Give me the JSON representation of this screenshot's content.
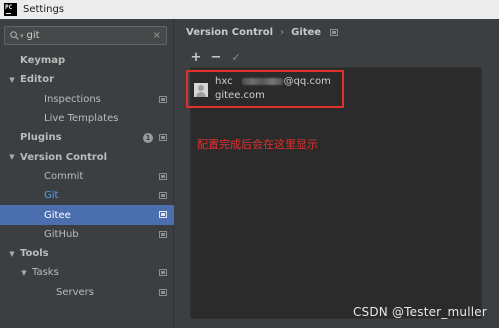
{
  "window": {
    "title": "Settings",
    "app_icon_text": "PC"
  },
  "search": {
    "value": "git",
    "caret": "▾",
    "clear": "×"
  },
  "tree": [
    {
      "label": "Keymap",
      "bold": true,
      "indent": 0
    },
    {
      "label": "Editor",
      "bold": true,
      "indent": 0,
      "arrow": "▼"
    },
    {
      "label": "Inspections",
      "indent": 2,
      "proj": true
    },
    {
      "label": "Live Templates",
      "indent": 2
    },
    {
      "label": "Plugins",
      "bold": true,
      "indent": 0,
      "badge": "1",
      "proj": true
    },
    {
      "label": "Version Control",
      "bold": true,
      "indent": 0,
      "arrow": "▼"
    },
    {
      "label": "Commit",
      "indent": 2,
      "proj": true
    },
    {
      "label": "Git",
      "indent": 2,
      "proj": true,
      "link": true
    },
    {
      "label": "Gitee",
      "indent": 2,
      "proj": true,
      "selected": true
    },
    {
      "label": "GitHub",
      "indent": 2,
      "proj": true
    },
    {
      "label": "Tools",
      "bold": true,
      "indent": 0,
      "arrow": "▼"
    },
    {
      "label": "Tasks",
      "indent": 1,
      "arrow": "▼",
      "proj": true
    },
    {
      "label": "Servers",
      "indent": 3,
      "proj": true
    }
  ],
  "breadcrumb": {
    "part1": "Version Control",
    "sep": "›",
    "part2": "Gitee"
  },
  "toolbar": {
    "add": "+",
    "remove": "−",
    "check": "✓"
  },
  "account": {
    "user_prefix": "hxc",
    "email_suffix": "@qq.com",
    "host": "gitee.com"
  },
  "note": "配置完成后会在这里显示",
  "watermark": "CSDN @Tester_muller"
}
